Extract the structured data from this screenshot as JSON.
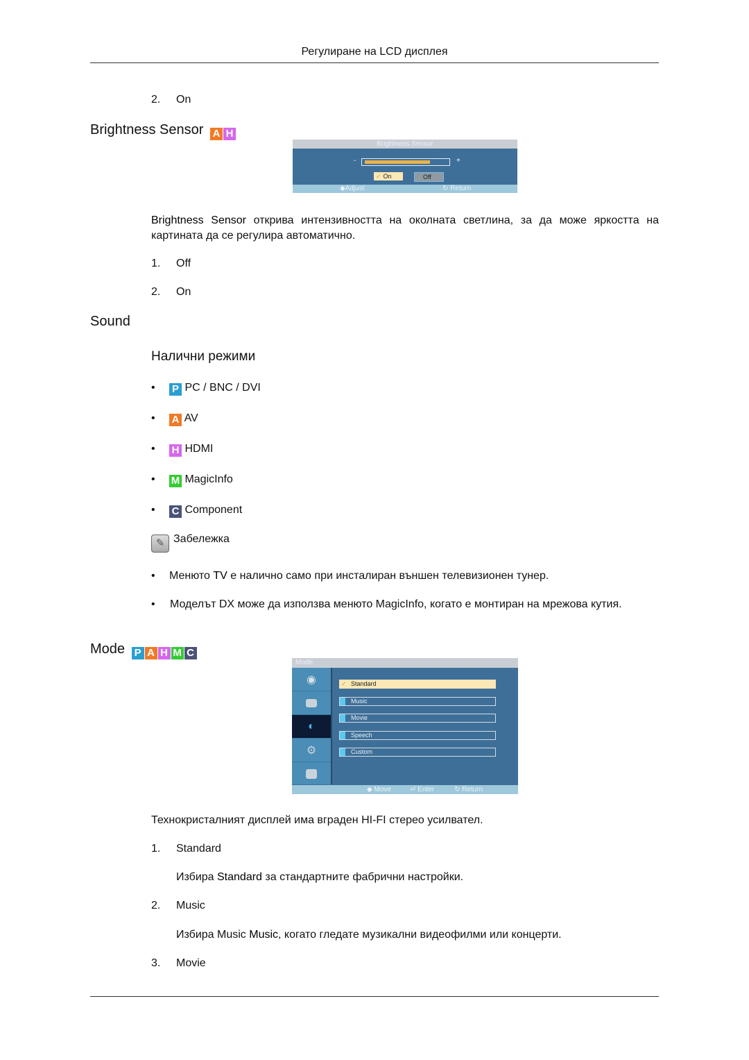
{
  "header": {
    "title": "Регулиране на LCD дисплея"
  },
  "prev_item": {
    "num": "2.",
    "label": "On"
  },
  "brightness_sensor": {
    "heading": "Brightness Sensor",
    "badges": [
      "A",
      "H"
    ],
    "osd": {
      "title": "Brightness Sensor",
      "minus": "-",
      "plus": "+",
      "slider_level_percent": 80,
      "on_label": "On",
      "off_label": "Off",
      "check_glyph": "✓",
      "footer_adjust": "Adjust",
      "footer_return": "Return"
    },
    "desc_bold": "Brightness Sensor",
    "desc_rest": " открива интензивността на околната светлина, за да може яркостта на картината да се регулира автоматично.",
    "options": [
      {
        "num": "1.",
        "label": "Off"
      },
      {
        "num": "2.",
        "label": "On"
      }
    ]
  },
  "sound": {
    "heading": "Sound",
    "subheading": "Налични режими",
    "modes": [
      {
        "badge": "P",
        "label": "PC / BNC / DVI"
      },
      {
        "badge": "A",
        "label": "AV"
      },
      {
        "badge": "H",
        "label": "HDMI"
      },
      {
        "badge": "M",
        "label": "MagicInfo"
      },
      {
        "badge": "C",
        "label": "Component"
      }
    ],
    "note_label": "Забележка",
    "notes": [
      {
        "pre": "Менюто ",
        "bold": "TV",
        "post": " е налично само при инсталиран външен телевизионен тунер."
      },
      {
        "pre": "Моделът DX може да използва менюто MagicInfo, когато е монтиран на мрежова кутия.",
        "bold": "",
        "post": ""
      }
    ]
  },
  "mode": {
    "heading": "Mode",
    "badges": [
      "P",
      "A",
      "H",
      "M",
      "C"
    ],
    "osd": {
      "title": "Mode",
      "items": [
        "Standard",
        "Music",
        "Movie",
        "Speech",
        "Custom"
      ],
      "selected": "Standard",
      "footer_move": "Move",
      "footer_enter": "Enter",
      "footer_return": "Return"
    },
    "intro": "Технокристалният дисплей има вграден HI-FI стерео усилвател.",
    "options": [
      {
        "num": "1.",
        "label": "Standard",
        "desc_pre": "Избира ",
        "desc_bold": "Standard",
        "desc_post": " за стандартните фабрични настройки."
      },
      {
        "num": "2.",
        "label": "Music",
        "desc_pre": "Избира Music ",
        "desc_bold": "Music",
        "desc_post": ", когато гледате музикални видеофилми или концерти."
      },
      {
        "num": "3.",
        "label": "Movie"
      }
    ]
  }
}
